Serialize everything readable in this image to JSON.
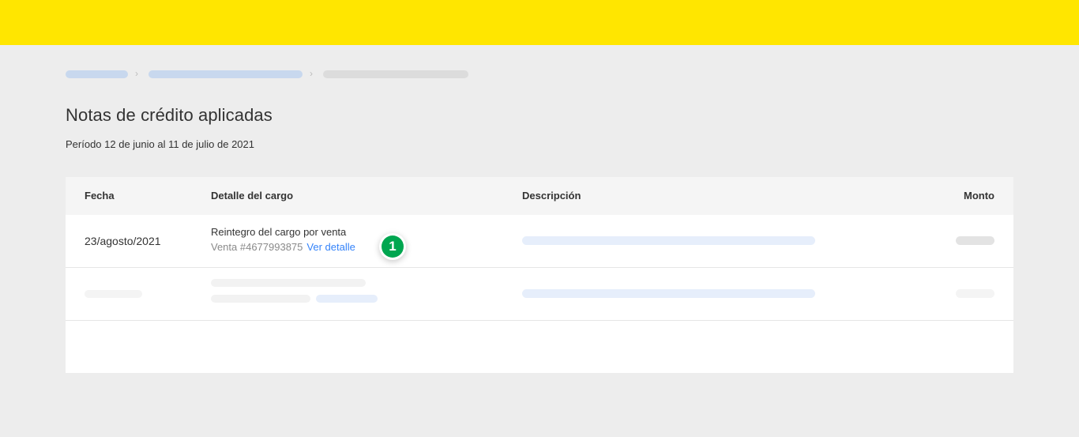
{
  "page": {
    "title": "Notas de crédito aplicadas",
    "period": "Período 12 de junio al 11 de julio de 2021"
  },
  "breadcrumb": {
    "separator": "›"
  },
  "table": {
    "headers": {
      "fecha": "Fecha",
      "detalle": "Detalle del cargo",
      "descripcion": "Descripción",
      "monto": "Monto"
    },
    "rows": [
      {
        "fecha": "23/agosto/2021",
        "detalle_title": "Reintegro del cargo por venta",
        "detalle_sale": "Venta #4677993875",
        "detalle_link": "Ver detalle"
      }
    ]
  },
  "step_badge": {
    "number": "1",
    "color": "#00a650"
  },
  "colors": {
    "topbar": "#ffe600",
    "link": "#3483fa",
    "background": "#ededed"
  }
}
